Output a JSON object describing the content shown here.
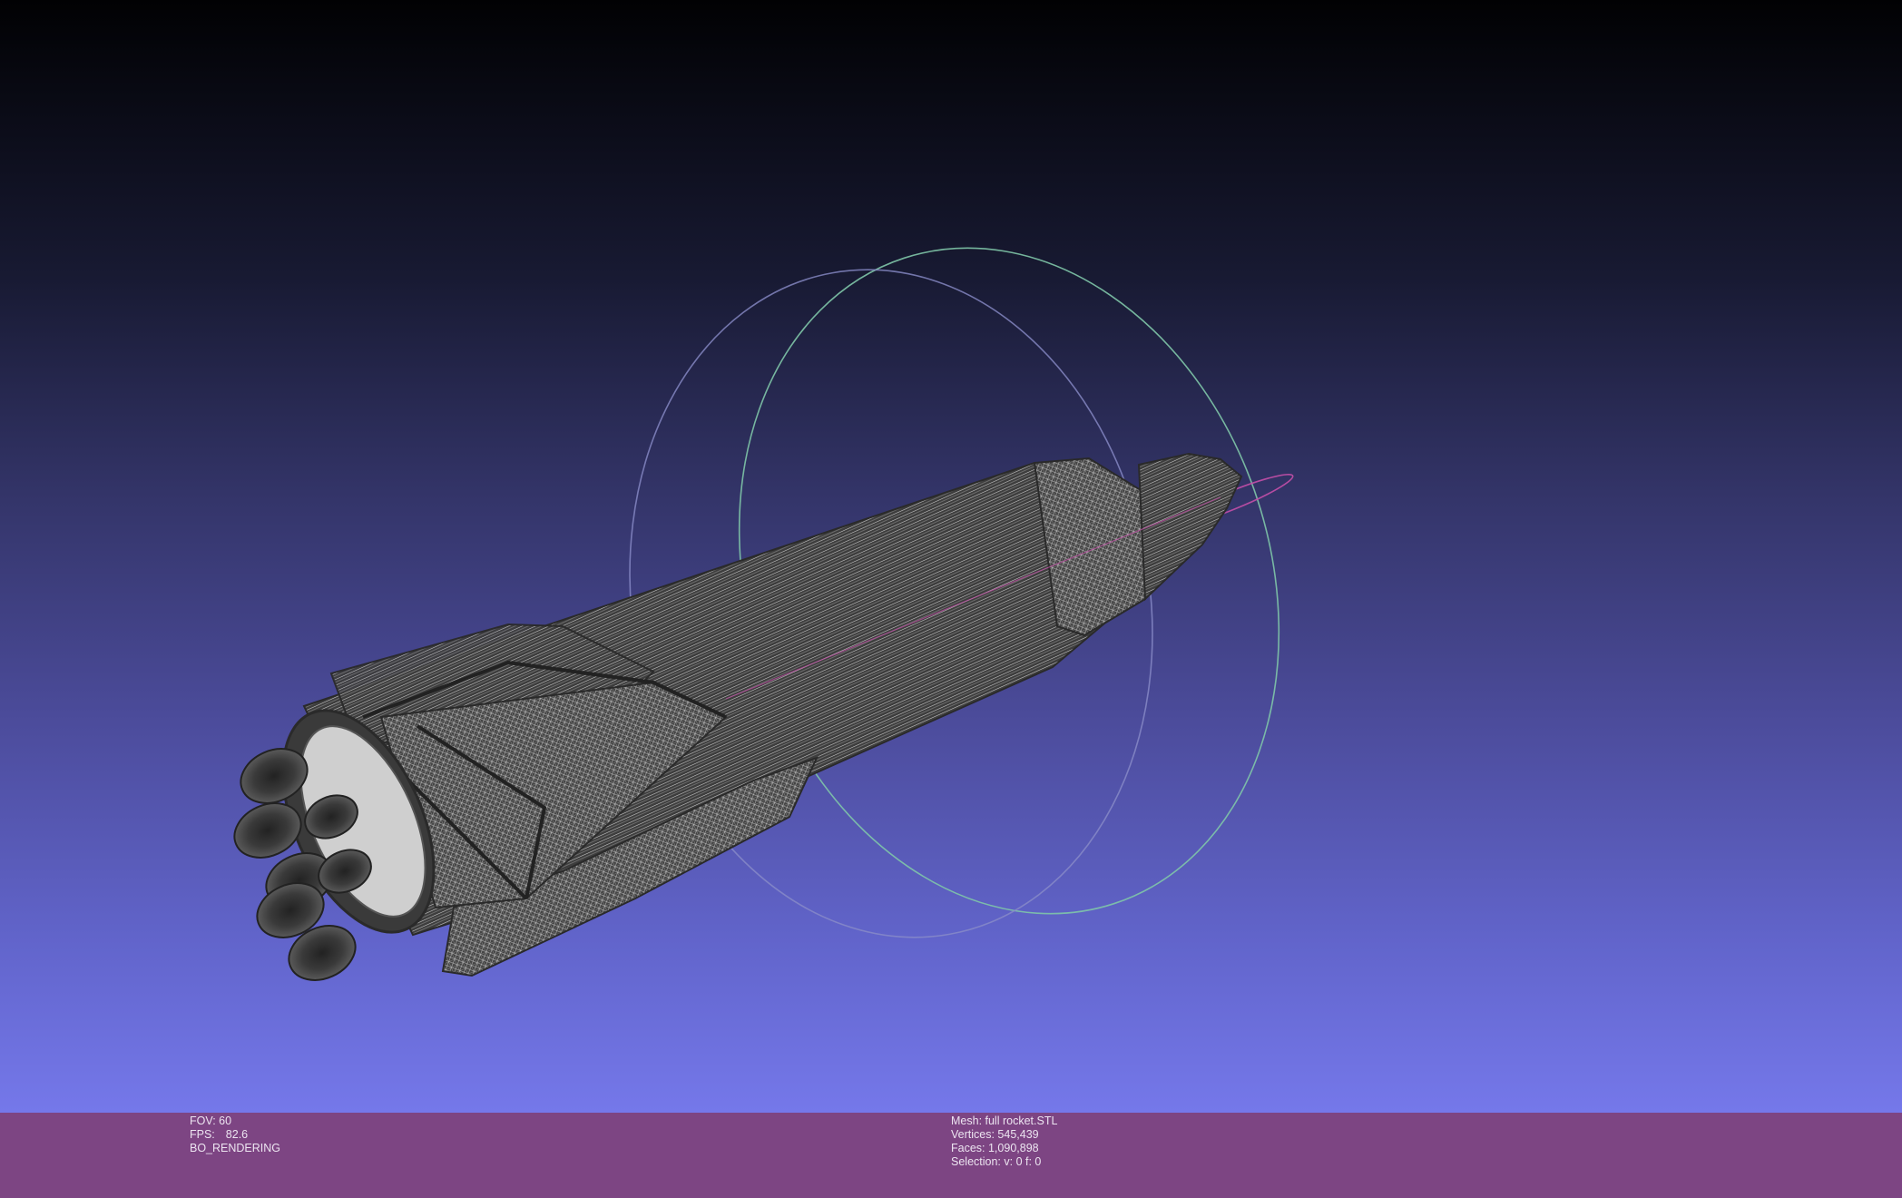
{
  "viewport": {
    "colors": {
      "background_top": "#010103",
      "background_bottom": "#7578ea",
      "mesh": "#4a4a4a",
      "wire": "#c8c8c8",
      "info_bar": "#7d4583"
    },
    "trackball": {
      "colors": [
        "#7fc6a8",
        "#8a8cc8",
        "#c44fa8"
      ]
    }
  },
  "render_info": {
    "fov": "FOV: 60",
    "fps_label": "FPS:",
    "fps_value": "82.6",
    "mode": "BO_RENDERING"
  },
  "mesh_info": {
    "mesh": "Mesh: full rocket.STL",
    "vertices": "Vertices: 545,439",
    "faces": "Faces: 1,090,898",
    "selection": "Selection: v: 0 f: 0"
  }
}
